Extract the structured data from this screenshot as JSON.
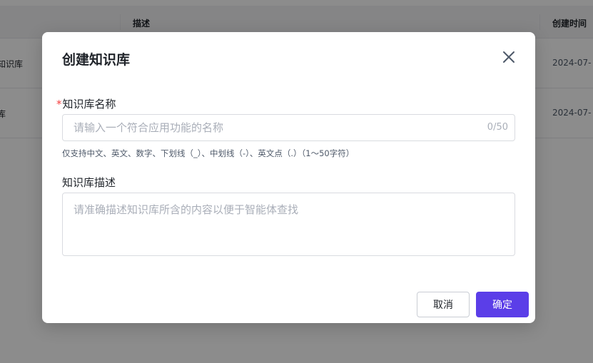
{
  "background": {
    "table": {
      "headers": {
        "description": "描述",
        "created_time": "创建时间"
      },
      "rows": [
        {
          "name": "知识库",
          "time": "2024-07-"
        },
        {
          "name": "库",
          "time": "2024-07-"
        }
      ]
    }
  },
  "modal": {
    "title": "创建知识库",
    "name_field": {
      "required_mark": "*",
      "label": "知识库名称",
      "placeholder": "请输入一个符合应用功能的名称",
      "value": "",
      "counter": "0/50",
      "hint": "仅支持中文、英文、数字、下划线（_）、中划线（-）、英文点（.）（1～50字符）"
    },
    "desc_field": {
      "label": "知识库描述",
      "placeholder": "请准确描述知识库所含的内容以便于智能体查找",
      "value": ""
    },
    "buttons": {
      "cancel": "取消",
      "confirm": "确定"
    },
    "icons": {
      "close": "close-icon"
    }
  },
  "colors": {
    "primary": "#5b3ee8",
    "required": "#f53f3f",
    "overlay": "rgba(0,0,0,0.45)"
  }
}
